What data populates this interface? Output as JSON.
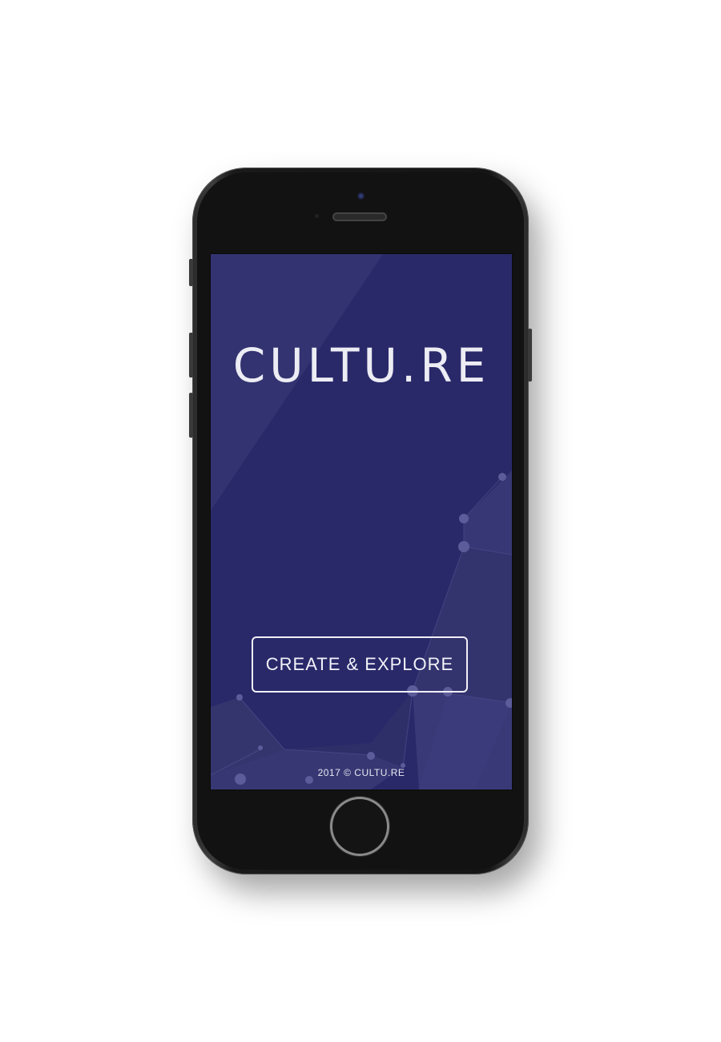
{
  "app": {
    "logo_text": "CULTU.RE",
    "cta_label": "CREATE & EXPLORE",
    "footer_text": "2017 © CULTU.RE"
  },
  "colors": {
    "screen_background": "#29296a",
    "accent_text": "#ececf4",
    "network_fill": "#3a3a78",
    "device_body": "#151515"
  },
  "device": {
    "icons": [
      "front-camera-icon",
      "earpiece-speaker-icon",
      "home-button-icon"
    ]
  }
}
